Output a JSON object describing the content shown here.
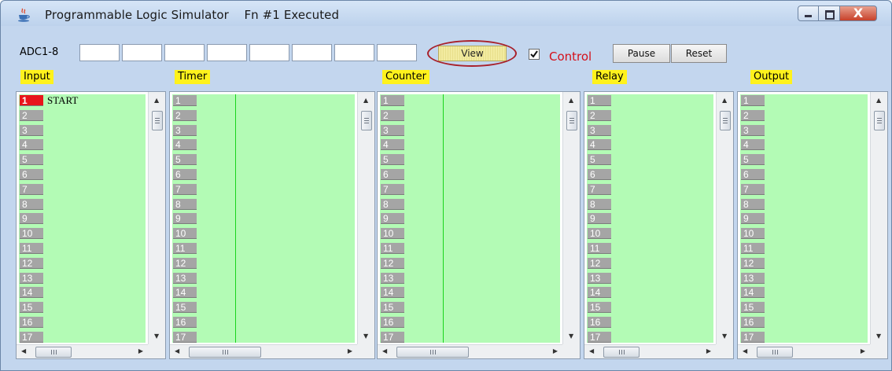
{
  "window": {
    "title": "Programmable Logic Simulator",
    "status": "Fn #1 Executed",
    "close_glyph": "X"
  },
  "toolbar": {
    "adc_label": "ADC1-8",
    "adc_values": [
      "",
      "",
      "",
      "",
      "",
      "",
      "",
      ""
    ],
    "view_label": "View",
    "control_label": "Control",
    "control_checked": true,
    "pause_label": "Pause",
    "reset_label": "Reset"
  },
  "panels": [
    {
      "id": "input",
      "label": "Input",
      "rows": [
        "1",
        "2",
        "3",
        "4",
        "5",
        "6",
        "7",
        "8",
        "9",
        "10",
        "11",
        "12",
        "13",
        "14",
        "15",
        "16",
        "17"
      ],
      "active_row": "1",
      "active_text": "START"
    },
    {
      "id": "timer",
      "label": "Timer",
      "rows": [
        "1",
        "2",
        "3",
        "4",
        "5",
        "6",
        "7",
        "8",
        "9",
        "10",
        "11",
        "12",
        "13",
        "14",
        "15",
        "16",
        "17"
      ]
    },
    {
      "id": "counter",
      "label": "Counter",
      "rows": [
        "1",
        "2",
        "3",
        "4",
        "5",
        "6",
        "7",
        "8",
        "9",
        "10",
        "11",
        "12",
        "13",
        "14",
        "15",
        "16",
        "17"
      ]
    },
    {
      "id": "relay",
      "label": "Relay",
      "rows": [
        "1",
        "2",
        "3",
        "4",
        "5",
        "6",
        "7",
        "8",
        "9",
        "10",
        "11",
        "12",
        "13",
        "14",
        "15",
        "16",
        "17"
      ]
    },
    {
      "id": "output",
      "label": "Output",
      "rows": [
        "1",
        "2",
        "3",
        "4",
        "5",
        "6",
        "7",
        "8",
        "9",
        "10",
        "11",
        "12",
        "13",
        "14",
        "15",
        "16",
        "17"
      ]
    }
  ],
  "colors": {
    "list_bg": "#b3fbb5",
    "row_bg": "#a5a5a5",
    "active_row": "#e8141b",
    "panel_label_bg": "#fff21c",
    "control_text": "#d4101a",
    "view_highlight_ring": "#a8212b"
  },
  "icons": {
    "app": "java-coffee-cup-icon",
    "minimize": "minimize-icon",
    "maximize": "maximize-icon",
    "close": "close-icon"
  }
}
